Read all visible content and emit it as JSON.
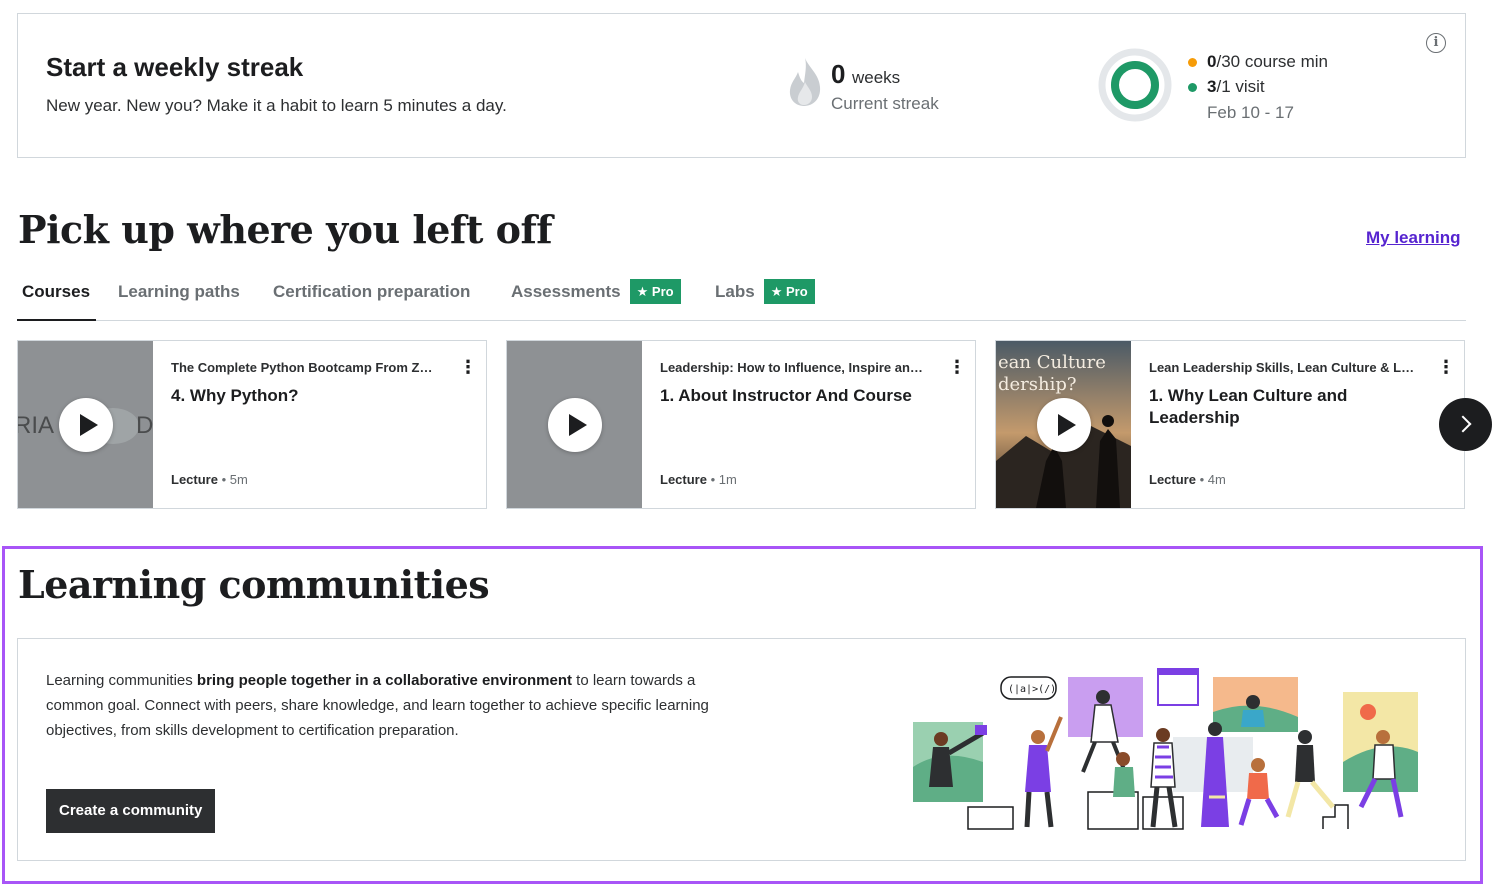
{
  "streak": {
    "title": "Start a weekly streak",
    "subtitle": "New year. New you? Make it a habit to learn 5 minutes a day.",
    "weeks_count": "0",
    "weeks_unit": "weeks",
    "current_label": "Current streak",
    "course_min_value": "0",
    "course_min_rest": "/30 course min",
    "visit_value": "3",
    "visit_rest": "/1 visit",
    "dates": "Feb 10 - 17",
    "course_min_fraction": 0,
    "visit_fraction": 1,
    "colors": {
      "course_min": "#f69c08",
      "visit": "#1e9966"
    },
    "icons": [
      "flame-icon",
      "progress-ring",
      "info-icon"
    ]
  },
  "pickup": {
    "title": "Pick up where you left off",
    "my_learning": "My learning",
    "tabs": [
      {
        "label": "Courses",
        "active": true
      },
      {
        "label": "Learning paths"
      },
      {
        "label": "Certification preparation"
      },
      {
        "label": "Assessments",
        "badge": "Pro"
      },
      {
        "label": "Labs",
        "badge": "Pro"
      }
    ],
    "cards": [
      {
        "course": "The Complete Python Bootcamp From Z…",
        "lecture": "4. Why Python?",
        "type": "Lecture",
        "duration": "5m"
      },
      {
        "course": "Leadership: How to Influence, Inspire an…",
        "lecture": "1. About Instructor And Course",
        "type": "Lecture",
        "duration": "1m"
      },
      {
        "course": "Lean Leadership Skills, Lean Culture & L…",
        "lecture": "1. Why Lean Culture and Leadership",
        "type": "Lecture",
        "duration": "4m",
        "thumb_text": [
          "ean Culture",
          "dership?"
        ]
      }
    ]
  },
  "communities": {
    "title": "Learning communities",
    "text_1": "Learning communities ",
    "text_bold": "bring people together in a collaborative environment",
    "text_2": " to learn towards a common goal. Connect with peers, share knowledge, and learn together to achieve specific learning objectives, from skills development to certification preparation.",
    "button": "Create a community",
    "illustration_bubble": "(|a|>(/)"
  }
}
